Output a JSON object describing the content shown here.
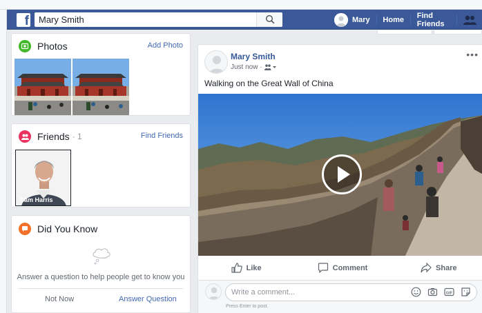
{
  "topbar": {
    "search_value": "Mary Smith",
    "user_name": "Mary",
    "nav_home": "Home",
    "nav_find_friends": "Find Friends",
    "brand_color": "#3b5998"
  },
  "photos_card": {
    "title": "Photos",
    "action": "Add Photo",
    "icon": "photo-icon"
  },
  "friends_card": {
    "title": "Friends",
    "count": "· 1",
    "action": "Find Friends",
    "friend_name": "Sam Harris",
    "icon": "friends-icon"
  },
  "dyk_card": {
    "title": "Did You Know",
    "prompt": "Answer a question to help people get to know you",
    "not_now": "Not Now",
    "answer": "Answer Question",
    "icon": "speech-bubble-icon"
  },
  "post": {
    "author": "Mary Smith",
    "time": "Just now ·",
    "privacy_icon": "friends-privacy-icon",
    "text": "Walking on the Great Wall of China",
    "actions": {
      "like": "Like",
      "comment": "Comment",
      "share": "Share"
    },
    "comment_placeholder": "Write a comment...",
    "comment_hint": "Press Enter to post."
  }
}
